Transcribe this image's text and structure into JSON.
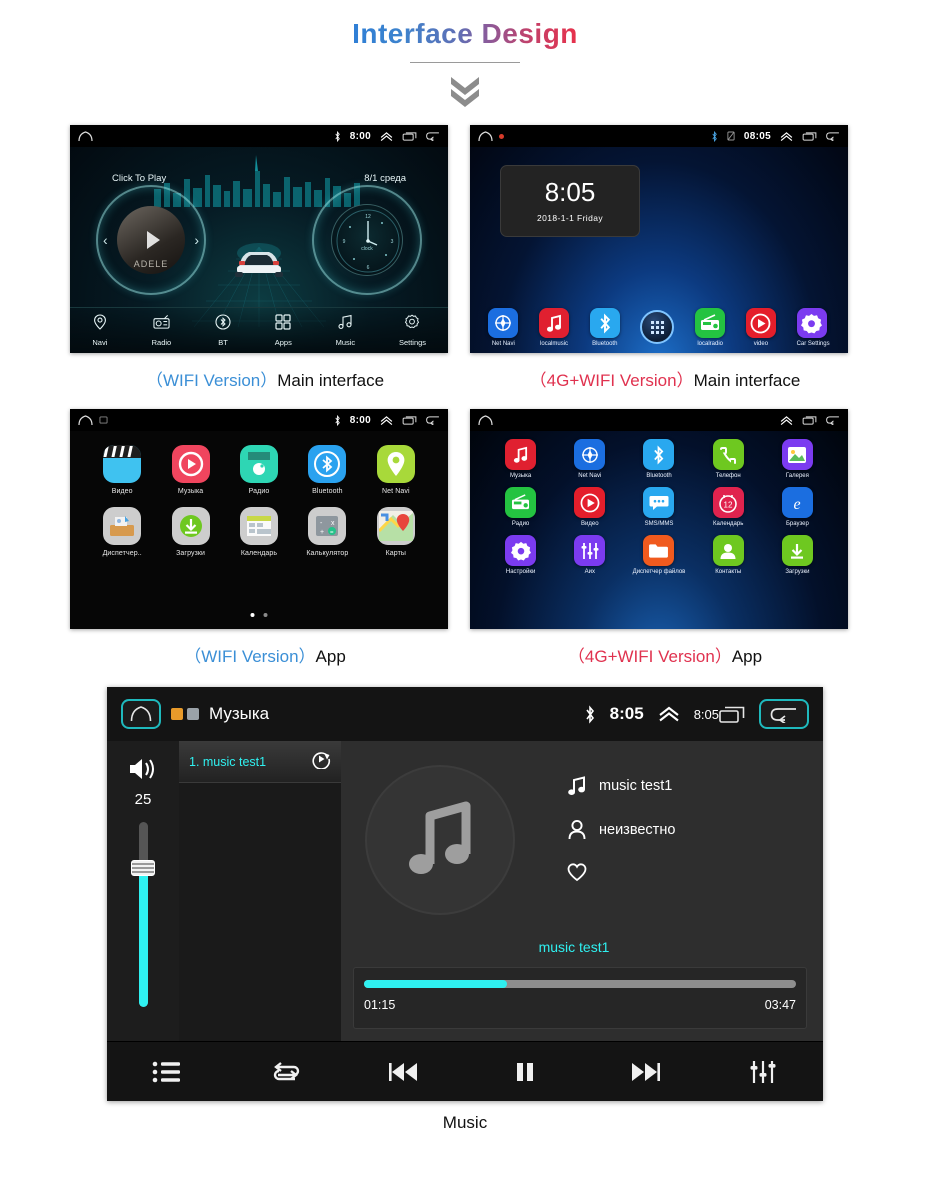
{
  "header": {
    "title": "Interface Design",
    "chevron_icon": "double-chevron-down-icon"
  },
  "screens": {
    "wifi_main": {
      "statusbar": {
        "home_icon": "home-icon",
        "bluetooth_icon": "bluetooth-icon",
        "time": "8:00",
        "up_icon": "chevron-up-icon",
        "recents_icon": "recents-icon",
        "back_icon": "back-icon"
      },
      "click_to_play": "Click To Play",
      "date": "8/1 среда",
      "album_label": "ADELE",
      "clock_label": "clock",
      "dock": [
        {
          "label": "Navi",
          "icon": "location-pin-icon"
        },
        {
          "label": "Radio",
          "icon": "radio-icon"
        },
        {
          "label": "BT",
          "icon": "bluetooth-icon"
        },
        {
          "label": "Apps",
          "icon": "apps-grid-icon"
        },
        {
          "label": "Music",
          "icon": "music-note-icon"
        },
        {
          "label": "Settings",
          "icon": "gear-icon"
        }
      ],
      "caption_version": "（WIFI Version）",
      "caption_text": "Main interface"
    },
    "fourg_main": {
      "statusbar": {
        "home_icon": "home-icon",
        "record_icon": "record-dot-icon",
        "bluetooth_icon": "bluetooth-icon",
        "sim_icon": "sim-card-icon",
        "time": "08:05",
        "up_icon": "chevron-up-icon",
        "recents_icon": "recents-icon",
        "back_icon": "back-icon"
      },
      "widget": {
        "time": "8:05",
        "date": "2018-1-1   Friday"
      },
      "dock": [
        {
          "label": "Net Navi",
          "icon": "compass-icon",
          "color": "#1b6ee0"
        },
        {
          "label": "localmusic",
          "icon": "music-note-icon",
          "color": "#e02030"
        },
        {
          "label": "Bluetooth",
          "icon": "bluetooth-icon",
          "color": "#29a8ef"
        },
        {
          "label": "",
          "icon": "app-drawer-icon",
          "color": "#13263f"
        },
        {
          "label": "localradio",
          "icon": "radio-icon",
          "color": "#24c341"
        },
        {
          "label": "video",
          "icon": "play-circle-icon",
          "color": "#e41e2b"
        },
        {
          "label": "Car Settings",
          "icon": "gear-icon",
          "color": "#7b3bf0"
        }
      ],
      "caption_version": "（4G+WIFI Version）",
      "caption_text": "Main interface"
    },
    "wifi_apps": {
      "statusbar": {
        "home_icon": "home-icon",
        "screenshot_icon": "screenshot-icon",
        "bluetooth_icon": "bluetooth-icon",
        "time": "8:00",
        "up_icon": "chevron-up-icon",
        "recents_icon": "recents-icon",
        "back_icon": "back-icon"
      },
      "apps": [
        {
          "label": "Видео",
          "icon": "clapperboard-icon",
          "color": "#3fc2f0"
        },
        {
          "label": "Музыка",
          "icon": "play-circle-icon",
          "color": "#f0455e"
        },
        {
          "label": "Радио",
          "icon": "radio-icon",
          "color": "#2ed6b4"
        },
        {
          "label": "Bluetooth",
          "icon": "bluetooth-icon",
          "color": "#2aa2ef"
        },
        {
          "label": "Net Navi",
          "icon": "location-pin-icon",
          "color": "#a8d93a"
        },
        {
          "label": "Диспетчер..",
          "icon": "file-manager-icon",
          "color": "#cdcdcd"
        },
        {
          "label": "Загрузки",
          "icon": "download-icon",
          "color": "#cdcdcd"
        },
        {
          "label": "Календарь",
          "icon": "calendar-icon",
          "color": "#cdcdcd"
        },
        {
          "label": "Калькулятор",
          "icon": "calculator-icon",
          "color": "#cdcdcd"
        },
        {
          "label": "Карты",
          "icon": "maps-icon",
          "color": "#cdcdcd"
        }
      ],
      "page_dots": 2,
      "active_dot": 0,
      "caption_version": "（WIFI Version）",
      "caption_text": "App"
    },
    "fourg_apps": {
      "statusbar": {
        "home_icon": "home-icon",
        "up_icon": "chevron-up-icon",
        "recents_icon": "recents-icon",
        "back_icon": "back-icon"
      },
      "apps": [
        {
          "label": "Музыка",
          "icon": "music-note-icon",
          "color": "#e02030"
        },
        {
          "label": "Net Navi",
          "icon": "compass-icon",
          "color": "#1b6ee0"
        },
        {
          "label": "Bluetooth",
          "icon": "bluetooth-icon",
          "color": "#29a8ef"
        },
        {
          "label": "Телефон",
          "icon": "phone-icon",
          "color": "#6ec820"
        },
        {
          "label": "Галерея",
          "icon": "gallery-icon",
          "color": "#7b3bf0"
        },
        {
          "label": "Радио",
          "icon": "radio-icon",
          "color": "#24c341"
        },
        {
          "label": "Видео",
          "icon": "play-circle-icon",
          "color": "#e41e2b"
        },
        {
          "label": "SMS/MMS",
          "icon": "message-icon",
          "color": "#29a8ef"
        },
        {
          "label": "Календарь",
          "icon": "calendar-icon",
          "color": "#e0234e"
        },
        {
          "label": "Браузер",
          "icon": "browser-e-icon",
          "color": "#1b6ee0"
        },
        {
          "label": "Настройки",
          "icon": "gear-icon",
          "color": "#7b3bf0"
        },
        {
          "label": "Аих",
          "icon": "equalizer-icon",
          "color": "#7b3bf0"
        },
        {
          "label": "Диспетчер файлов",
          "icon": "folder-icon",
          "color": "#f05a1e"
        },
        {
          "label": "Контакты",
          "icon": "contacts-icon",
          "color": "#6ec820"
        },
        {
          "label": "Загрузки",
          "icon": "download-icon",
          "color": "#6ec820"
        }
      ],
      "caption_version": "（4G+WIFI Version）",
      "caption_text": "App"
    },
    "music_player": {
      "statusbar": {
        "home_icon": "home-icon",
        "music_badge_icon": "music-badge-icon",
        "screenshot_badge_icon": "screenshot-badge-icon",
        "title": "Музыка",
        "bluetooth_icon": "bluetooth-icon",
        "time": "8:05",
        "up_icon": "chevron-up-icon",
        "time_small": "8:05",
        "recents_icon": "recents-icon",
        "back_icon": "back-icon"
      },
      "volume": {
        "icon": "volume-icon",
        "value": "25",
        "fill_percent": 75
      },
      "playlist": [
        {
          "label": "1. music test1",
          "icon": "play-ring-icon"
        }
      ],
      "album_art_icon": "music-note-icon",
      "meta": [
        {
          "icon": "music-note-icon",
          "text": "music test1"
        },
        {
          "icon": "person-icon",
          "text": "неизвестно"
        },
        {
          "icon": "heart-icon",
          "text": ""
        }
      ],
      "now_playing": "music test1",
      "progress": {
        "elapsed": "01:15",
        "total": "03:47",
        "percent": 33
      },
      "controls": [
        {
          "name": "playlist",
          "icon": "list-icon"
        },
        {
          "name": "repeat",
          "icon": "repeat-icon"
        },
        {
          "name": "previous",
          "icon": "previous-icon"
        },
        {
          "name": "pause",
          "icon": "pause-icon"
        },
        {
          "name": "next",
          "icon": "next-icon"
        },
        {
          "name": "equalizer",
          "icon": "equalizer-icon"
        }
      ],
      "caption": "Music"
    }
  },
  "colors": {
    "wifi_blue": "#3b8fd6",
    "fourg_red": "#e0324f",
    "accent_cyan": "#2ff0f0"
  }
}
